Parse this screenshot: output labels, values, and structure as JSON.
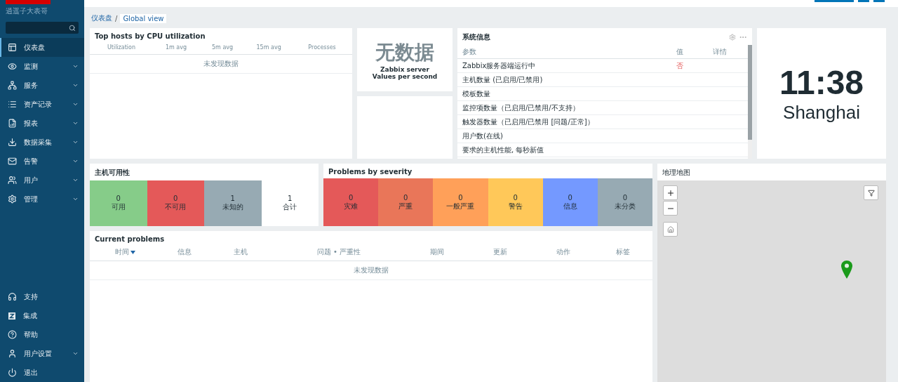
{
  "sidebar": {
    "subtitle": "逍遥子大表哥",
    "items": [
      {
        "label": "仪表盘",
        "selected": true,
        "expandable": false
      },
      {
        "label": "监测",
        "selected": false,
        "expandable": true
      },
      {
        "label": "服务",
        "selected": false,
        "expandable": true
      },
      {
        "label": "资产记录",
        "selected": false,
        "expandable": true
      },
      {
        "label": "报表",
        "selected": false,
        "expandable": true
      },
      {
        "label": "数据采集",
        "selected": false,
        "expandable": true
      },
      {
        "label": "告警",
        "selected": false,
        "expandable": true
      },
      {
        "label": "用户",
        "selected": false,
        "expandable": true
      },
      {
        "label": "管理",
        "selected": false,
        "expandable": true
      }
    ],
    "bottom_items": [
      {
        "label": "支持",
        "expandable": false
      },
      {
        "label": "集成",
        "expandable": false
      },
      {
        "label": "帮助",
        "expandable": false
      },
      {
        "label": "用户设置",
        "expandable": true
      },
      {
        "label": "退出",
        "expandable": false
      }
    ]
  },
  "breadcrumb": {
    "items": [
      "仪表盘",
      "Global view"
    ],
    "separator": "/"
  },
  "cpu_widget": {
    "title": "Top hosts by CPU utilization",
    "columns": [
      "Utilization",
      "1m avg",
      "5m avg",
      "15m avg",
      "Processes"
    ],
    "empty": "未发现数据"
  },
  "values_widget": {
    "big": "无数据",
    "line_1": "Zabbix server",
    "line_2": "Values per second"
  },
  "system_info": {
    "title": "系统信息",
    "columns": [
      "参数",
      "值",
      "详情"
    ],
    "rows": [
      {
        "param": "Zabbix服务器端运行中",
        "value": "否"
      },
      {
        "param": "主机数量 (已启用/已禁用)"
      },
      {
        "param": "模板数量"
      },
      {
        "param": "监控项数量（已启用/已禁用/不支持）"
      },
      {
        "param": "触发器数量（已启用/已禁用 [问题/正常]）"
      },
      {
        "param": "用户数(在线)"
      },
      {
        "param": "要求的主机性能, 每秒新值"
      }
    ]
  },
  "clock": {
    "time": "11:38",
    "city": "Shanghai"
  },
  "host_availability": {
    "title": "主机可用性",
    "items": [
      {
        "count": "0",
        "label": "可用",
        "color": "#86cc89"
      },
      {
        "count": "0",
        "label": "不可用",
        "color": "#e45959"
      },
      {
        "count": "1",
        "label": "未知的",
        "color": "#97aab3"
      },
      {
        "count": "1",
        "label": "合计",
        "color": "#ffffff"
      }
    ]
  },
  "problems_by_severity": {
    "title": "Problems by severity",
    "items": [
      {
        "count": "0",
        "label": "灾难",
        "color": "#e45959"
      },
      {
        "count": "0",
        "label": "严重",
        "color": "#e97659"
      },
      {
        "count": "0",
        "label": "一般严重",
        "color": "#ffa059"
      },
      {
        "count": "0",
        "label": "警告",
        "color": "#ffc859"
      },
      {
        "count": "0",
        "label": "信息",
        "color": "#7499ff"
      },
      {
        "count": "0",
        "label": "未分类",
        "color": "#97aab3"
      }
    ]
  },
  "current_problems": {
    "title": "Current problems",
    "columns": [
      {
        "label": "时间",
        "sorted": true
      },
      {
        "label": "信息",
        "sorted": false
      },
      {
        "label": "主机",
        "sorted": false
      },
      {
        "label": "问题 • 严重性",
        "sorted": false
      },
      {
        "label": "期间",
        "sorted": false
      },
      {
        "label": "更新",
        "sorted": false
      },
      {
        "label": "动作",
        "sorted": false
      },
      {
        "label": "标签",
        "sorted": false
      }
    ],
    "empty": "未发现数据"
  },
  "geomap": {
    "title": "地理地图"
  }
}
